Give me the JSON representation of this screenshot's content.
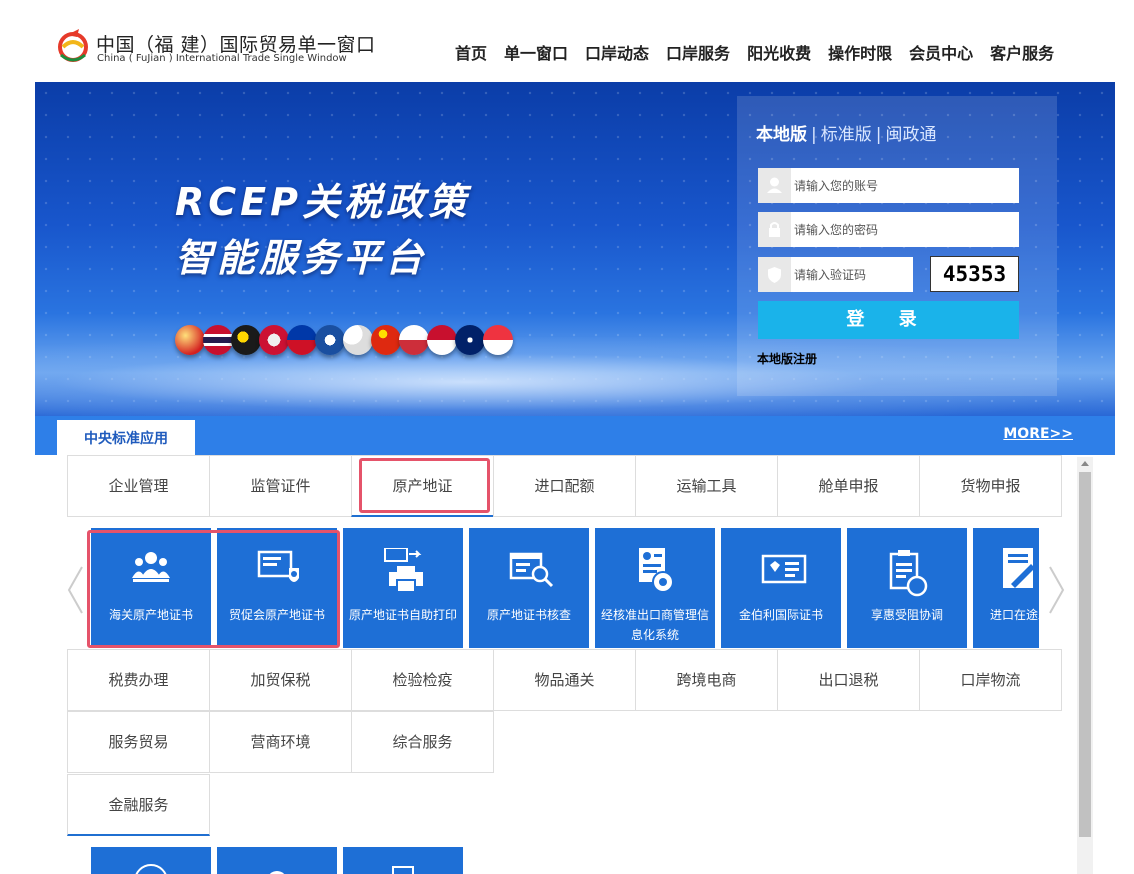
{
  "header": {
    "title_cn": "中国（福 建）国际贸易单一窗口",
    "title_en": "China (   FuJian   ) International Trade Single  Window",
    "nav": [
      "首页",
      "单一窗口",
      "口岸动态",
      "口岸服务",
      "阳光收费",
      "操作时限",
      "会员中心",
      "客户服务"
    ]
  },
  "banner": {
    "title_line1": "RCEP关税政策",
    "title_line2": "智能服务平台"
  },
  "login": {
    "tabs": [
      "本地版",
      "标准版",
      "闽政通"
    ],
    "separator": "|",
    "account_placeholder": "请输入您的账号",
    "password_placeholder": "请输入您的密码",
    "captcha_placeholder": "请输入验证码",
    "captcha_code": "45353",
    "login_button": "登 录",
    "register_link": "本地版注册"
  },
  "section": {
    "tab_label": "中央标准应用",
    "more_link": "MORE>>"
  },
  "tabs_row1": [
    "企业管理",
    "监管证件",
    "原产地证",
    "进口配额",
    "运输工具",
    "舱单申报",
    "货物申报"
  ],
  "tabs_row2": [
    "税费办理",
    "加贸保税",
    "检验检疫",
    "物品通关",
    "跨境电商",
    "出口退税",
    "口岸物流"
  ],
  "tabs_row3": [
    "服务贸易",
    "营商环境",
    "综合服务"
  ],
  "tabs_row4": [
    "金融服务"
  ],
  "active_tab": "原产地证",
  "apps": [
    {
      "label": "海关原产地证书",
      "icon": "users-icon"
    },
    {
      "label": "贸促会原产地证书",
      "icon": "certificate-globe-icon"
    },
    {
      "label": "原产地证书自助打印",
      "icon": "printer-icon"
    },
    {
      "label": "原产地证书核查",
      "icon": "window-search-icon"
    },
    {
      "label": "经核准出口商管理信息化系统",
      "icon": "document-gear-icon"
    },
    {
      "label": "金伯利国际证书",
      "icon": "diamond-card-icon"
    },
    {
      "label": "享惠受阻协调",
      "icon": "clipboard-stamp-icon"
    },
    {
      "label": "进口在途发税率适",
      "icon": "book-pen-icon"
    }
  ],
  "colors": {
    "tile_blue": "#1e6fd6",
    "highlight_red": "#e5536a",
    "login_button": "#1ab3ea",
    "section_blue": "#2e7fe8"
  }
}
